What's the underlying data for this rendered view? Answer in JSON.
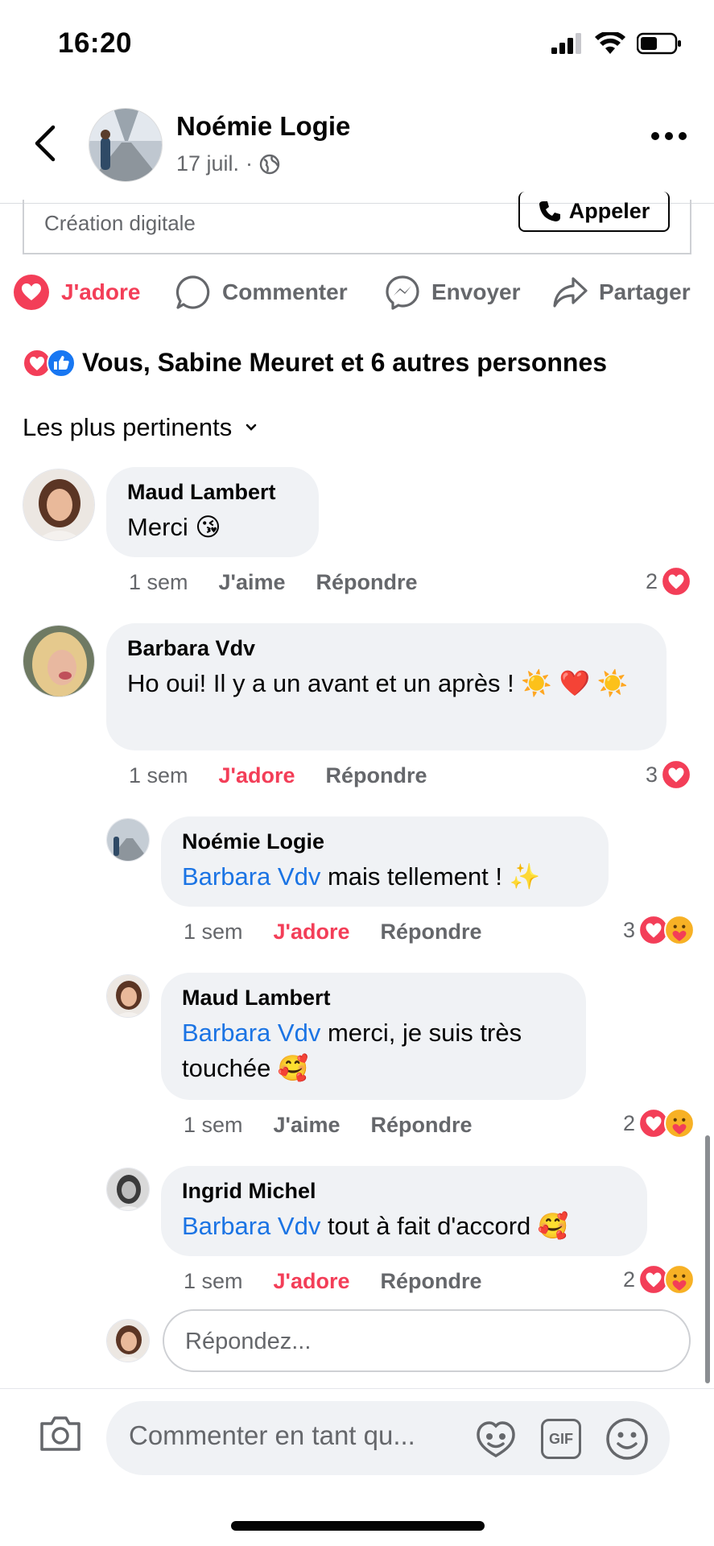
{
  "status_bar": {
    "time": "16:20"
  },
  "header": {
    "author": "Noémie Logie",
    "date": "17 juil.",
    "separator": "·"
  },
  "post": {
    "page_category": "Création digitale",
    "call_button": "Appeler"
  },
  "actions": {
    "love": "J'adore",
    "comment": "Commenter",
    "send": "Envoyer",
    "share": "Partager"
  },
  "reactions_summary": "Vous, Sabine Meuret et 6 autres personnes",
  "sort_label": "Les plus pertinents",
  "comments": [
    {
      "author": "Maud Lambert",
      "text": "Merci 😘",
      "time": "1 sem",
      "like": "J'aime",
      "reply": "Répondre",
      "reactions": "2"
    },
    {
      "author": "Barbara Vdv",
      "text": "Ho oui! Il y a un avant et un après ! ☀️ ❤️ ☀️",
      "time": "1 sem",
      "like": "J'adore",
      "reply": "Répondre",
      "reactions": "3"
    }
  ],
  "replies": [
    {
      "author": "Noémie Logie",
      "mention": "Barbara Vdv",
      "text": " mais tellement ! ✨",
      "time": "1 sem",
      "like": "J'adore",
      "reply": "Répondre",
      "reactions": "3"
    },
    {
      "author": "Maud Lambert",
      "mention": "Barbara Vdv",
      "text": " merci, je suis très touchée 🥰",
      "time": "1 sem",
      "like": "J'aime",
      "reply": "Répondre",
      "reactions": "2"
    },
    {
      "author": "Ingrid Michel",
      "mention": "Barbara Vdv",
      "text": " tout à fait d'accord 🥰",
      "time": "1 sem",
      "like": "J'adore",
      "reply": "Répondre",
      "reactions": "2"
    }
  ],
  "reply_placeholder": "Répondez...",
  "composer_placeholder": "Commenter en tant qu...",
  "composer_gif": "GIF",
  "colors": {
    "love": "#f33e58",
    "like": "#1877f2",
    "mention": "#1b74e4",
    "secondary_text": "#65676b",
    "bubble": "#f0f2f5"
  }
}
